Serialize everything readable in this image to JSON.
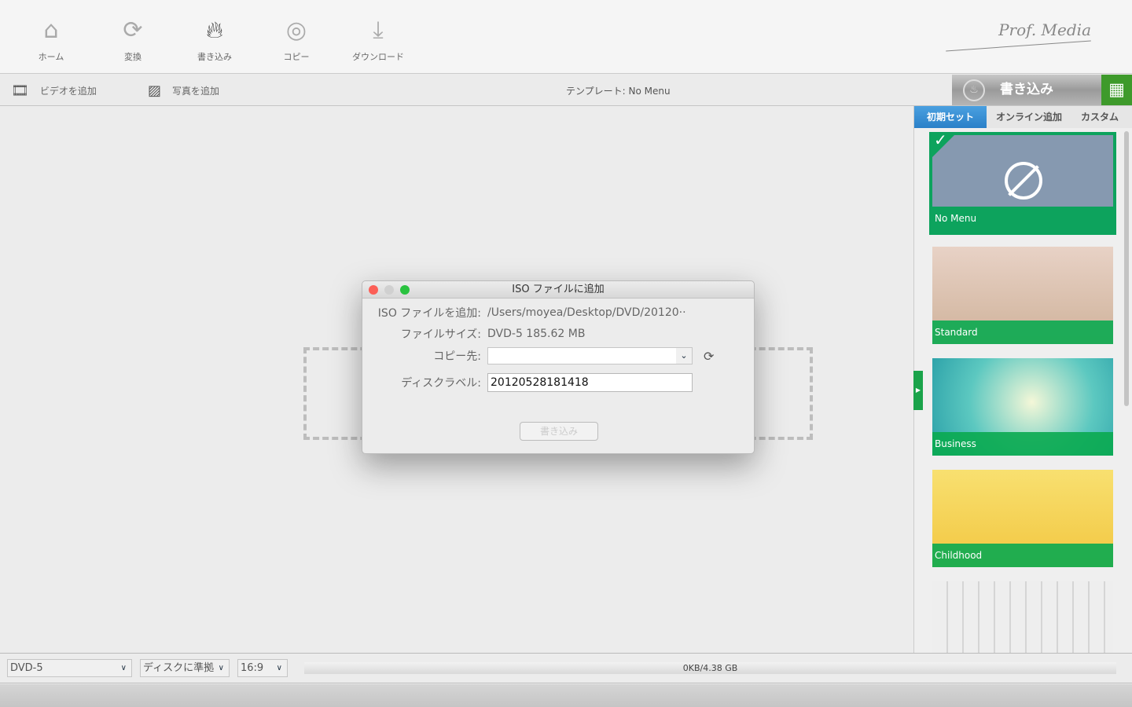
{
  "toolbar": {
    "items": [
      {
        "label": "ホーム",
        "icon": "home-icon"
      },
      {
        "label": "変換",
        "icon": "convert-icon"
      },
      {
        "label": "書き込み",
        "icon": "burn-icon"
      },
      {
        "label": "コピー",
        "icon": "copy-icon"
      },
      {
        "label": "ダウンロード",
        "icon": "download-icon"
      }
    ],
    "active": "書き込み"
  },
  "logo": "Prof. Media",
  "actionbar": {
    "add_video": "ビデオを追加",
    "add_photo": "写真を追加",
    "template": "テンプレート: No Menu",
    "burn": "書き込み"
  },
  "sidebar": {
    "tabs": [
      "初期セット",
      "オンライン追加",
      "カスタム"
    ],
    "active_tab": "初期セット",
    "templates": [
      "No Menu",
      "Standard",
      "Business",
      "Childhood"
    ],
    "selected": "No Menu"
  },
  "dialog": {
    "title": "ISO ファイルに追加",
    "rows": {
      "iso_label": "ISO ファイルを追加:",
      "iso_value": "/Users/moyea/Desktop/DVD/20120··",
      "size_label": "ファイルサイズ:",
      "size_value": "DVD-5 185.62 MB",
      "dest_label": "コピー先:",
      "dest_value": "",
      "disc_label": "ディスクラベル:",
      "disc_value": "20120528181418"
    },
    "burn_button": "書き込み"
  },
  "bottom": {
    "disc_type": "DVD-5",
    "fit": "ディスクに準拠",
    "aspect": "16:9",
    "capacity": "0KB/4.38 GB"
  }
}
